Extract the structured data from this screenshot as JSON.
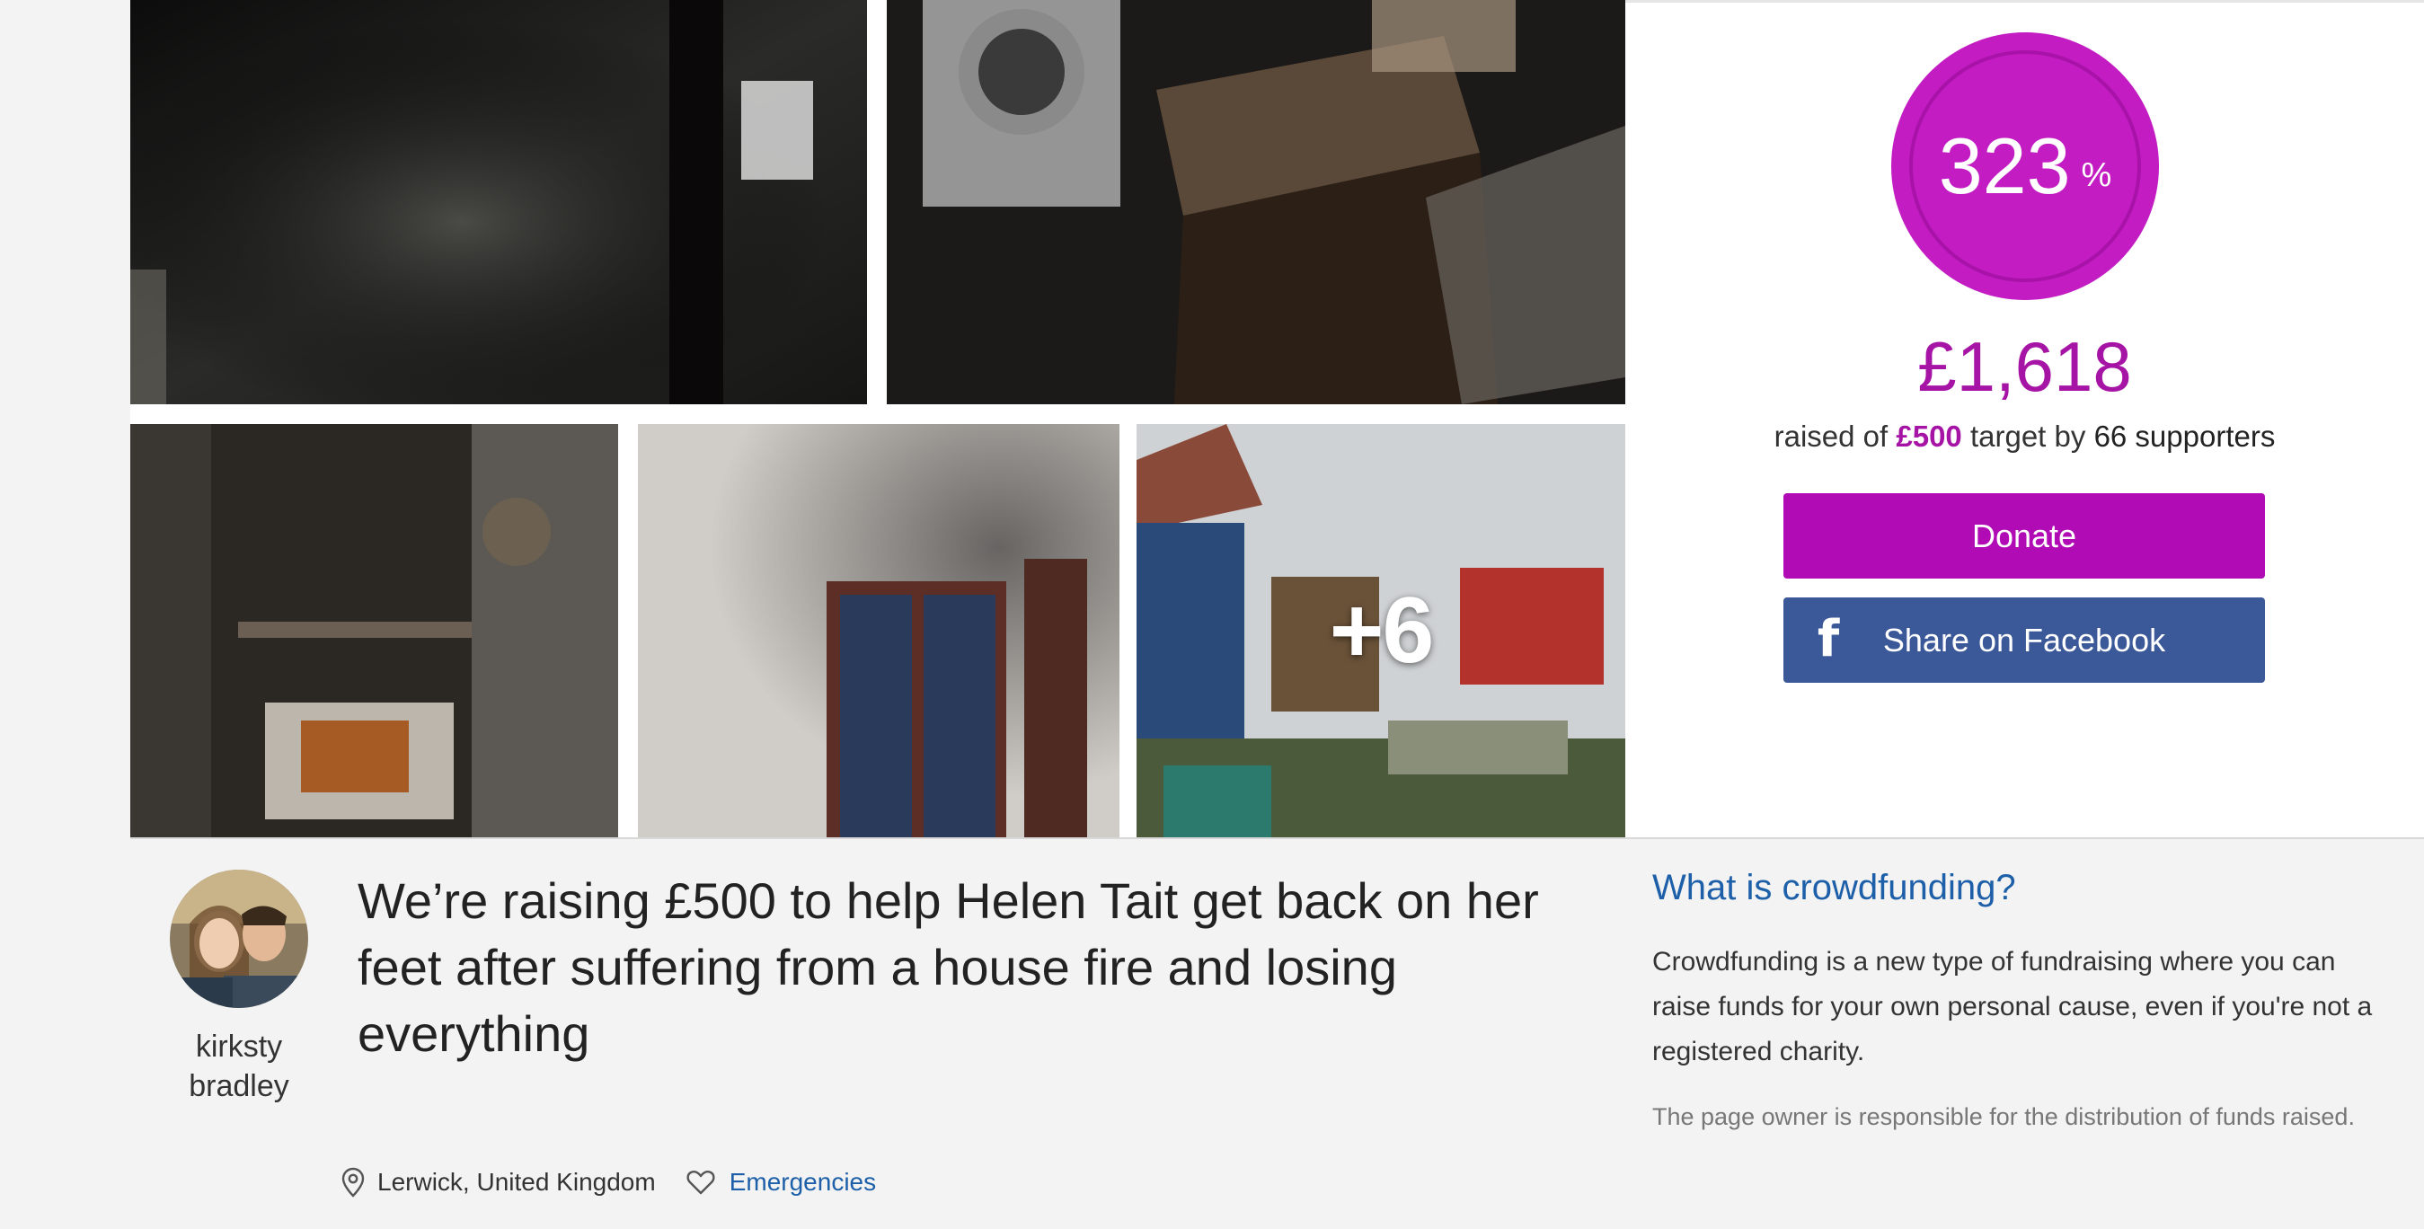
{
  "gallery": {
    "more_photos": "+6"
  },
  "donate_panel": {
    "progress_percent_value": "323",
    "progress_percent_sign": "%",
    "progress_fraction": 3.23,
    "raised_amount": "£1,618",
    "raised_prefix": "raised of",
    "target_amount": "£500",
    "target_middle": "target by",
    "supporters": "66 supporters",
    "donate_label": "Donate",
    "facebook_label": "Share on Facebook",
    "facebook_icon": "f"
  },
  "creator": {
    "first_name": "kirksty",
    "last_name": "bradley"
  },
  "campaign": {
    "title": "We’re raising £500 to help Helen Tait get back on her feet after suffering from a house fire and losing everything",
    "location": "Lerwick, United Kingdom",
    "category": "Emergencies"
  },
  "info": {
    "title": "What is crowdfunding?",
    "body": "Crowdfunding is a new type of fundraising where you can raise funds for your own personal cause, even if you're not a registered charity.",
    "note": "The page owner is responsible for the distribution of funds raised."
  },
  "colors": {
    "brand_purple": "#b10bb5",
    "ring_purple": "#c21cc2",
    "facebook_blue": "#3b5998",
    "link_blue": "#1d5fa8"
  },
  "icons": [
    "location-pin-icon",
    "heart-icon",
    "facebook-icon"
  ]
}
